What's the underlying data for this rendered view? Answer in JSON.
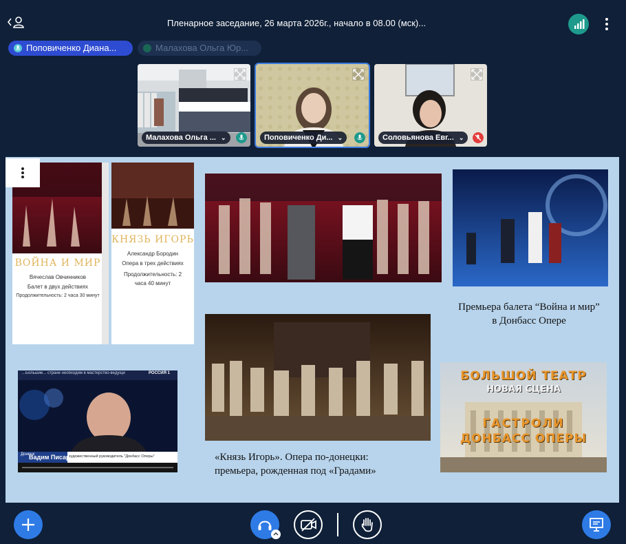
{
  "meeting": {
    "title": "Пленарное заседание, 26 марта 2026г., начало в 08.00 (мск)..."
  },
  "speakers": [
    {
      "name": "Поповиченко Диана...",
      "active": true
    },
    {
      "name": "Малахова Ольга Юр...",
      "active": false
    }
  ],
  "tiles": [
    {
      "name": "Малахова Ольга ...",
      "mic": "on"
    },
    {
      "name": "Поповиченко Ди...",
      "mic": "on"
    },
    {
      "name": "Соловьянова Евг...",
      "mic": "muted"
    }
  ],
  "slide": {
    "poster1": {
      "title": "ВОЙНА И МИР",
      "composer": "Вячеслав Овчинников",
      "subtitle": "Балет в двух действиях",
      "duration": "Продолжительность: 2 часа 30 минут"
    },
    "poster2": {
      "title": "КНЯЗЬ ИГОРЬ",
      "composer": "Александр Бородин",
      "subtitle": "Опера в трех действиях",
      "duration": "Продолжительность: 2 часа 40 минут"
    },
    "caption_ballet_line1": "Премьера балета “Война и мир”",
    "caption_ballet_line2": "в Донбасс Опере",
    "caption_opera_line1": "«Князь Игорь». Опера по-донецки:",
    "caption_opera_line2": "премьера, рожденная под «Градами»",
    "video": {
      "headline": "...Большие... стране необходим в мастерство-ведущих",
      "channel": "РОССИЯ 1",
      "region": "Донецк",
      "person_name": "Вадим Писарев",
      "person_role": "художественный руководитель \"Донбасс Оперы\""
    },
    "bolshoi": {
      "line1": "БОЛЬШОЙ ТЕАТР",
      "line2": "НОВАЯ СЦЕНА",
      "line3": "ГАСТРОЛИ",
      "line4": "ДОНБАСС ОПЕРЫ"
    }
  },
  "colors": {
    "background": "#0f2038",
    "accent": "#2f7be6",
    "chip_active": "#2e4cd1",
    "signal": "#1d9a8c",
    "slide_bg": "#b8d4ec"
  }
}
